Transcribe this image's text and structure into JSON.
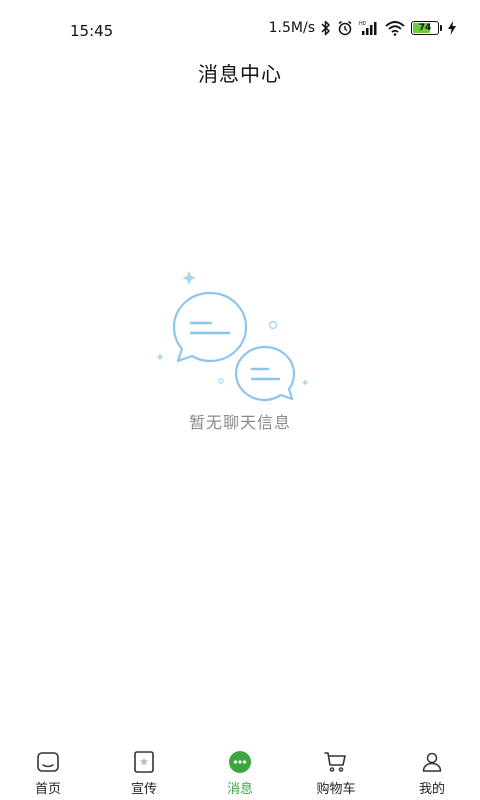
{
  "status_bar": {
    "time": "15:45",
    "network_speed": "1.5M/s",
    "battery_level": "74",
    "battery_percent": 74,
    "icons": [
      "bluetooth-icon",
      "alarm-icon",
      "hd-signal-icon",
      "wifi-icon",
      "battery-icon",
      "charging-icon"
    ]
  },
  "header": {
    "title": "消息中心"
  },
  "empty_state": {
    "message": "暂无聊天信息",
    "illustration": "chat-bubbles-icon"
  },
  "tab_bar": {
    "active_tab": "消息",
    "accent_color": "#3aa63d",
    "items": [
      {
        "label": "首页",
        "icon": "home-icon"
      },
      {
        "label": "宣传",
        "icon": "promotion-icon"
      },
      {
        "label": "消息",
        "icon": "message-icon"
      },
      {
        "label": "购物车",
        "icon": "cart-icon"
      },
      {
        "label": "我的",
        "icon": "profile-icon"
      }
    ]
  }
}
